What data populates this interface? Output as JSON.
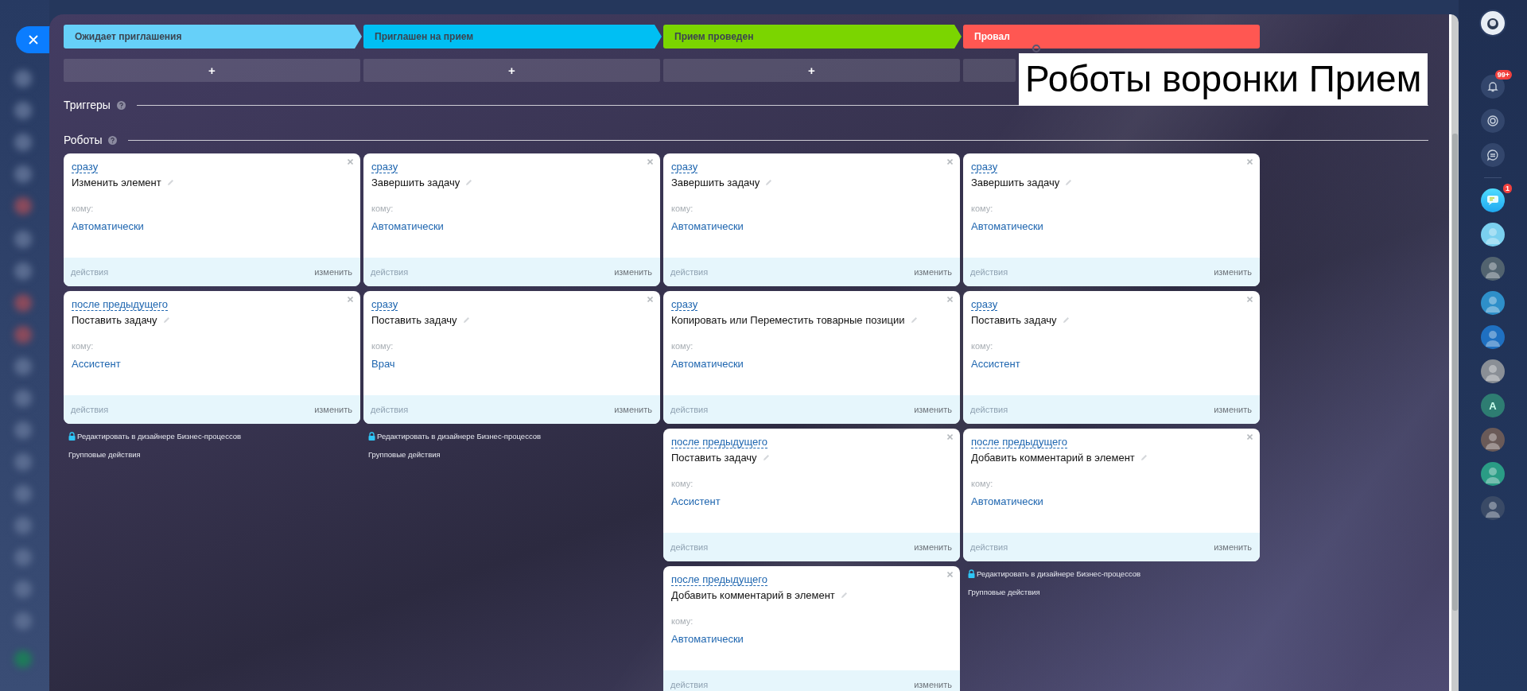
{
  "stages": [
    {
      "name": "Ожидает приглашения",
      "color": "#66d0f9",
      "add_label": "+"
    },
    {
      "name": "Приглашен на прием",
      "color": "#00bff3",
      "add_label": "+"
    },
    {
      "name": "Прием проведен",
      "color": "#7bd500",
      "add_label": "+"
    },
    {
      "name": "Провал",
      "color": "#ff5752"
    }
  ],
  "sections": {
    "triggers": "Триггеры",
    "robots": "Роботы"
  },
  "columns": [
    {
      "robots": [
        {
          "delay": "сразу",
          "title": "Изменить элемент",
          "to_label": "кому:",
          "assignee": "Автоматически",
          "actions": "действия",
          "edit": "изменить"
        },
        {
          "delay": "после предыдущего",
          "title": "Поставить задачу",
          "to_label": "кому:",
          "assignee": "Ассистент",
          "actions": "действия",
          "edit": "изменить"
        }
      ],
      "links": [
        "Редактировать в дизайнере Бизнес-процессов",
        "Групповые действия"
      ]
    },
    {
      "robots": [
        {
          "delay": "сразу",
          "title": "Завершить задачу",
          "to_label": "кому:",
          "assignee": "Автоматически",
          "actions": "действия",
          "edit": "изменить"
        },
        {
          "delay": "сразу",
          "title": "Поставить задачу",
          "to_label": "кому:",
          "assignee": "Врач",
          "actions": "действия",
          "edit": "изменить"
        }
      ],
      "links": [
        "Редактировать в дизайнере Бизнес-процессов",
        "Групповые действия"
      ]
    },
    {
      "robots": [
        {
          "delay": "сразу",
          "title": "Завершить задачу",
          "to_label": "кому:",
          "assignee": "Автоматически",
          "actions": "действия",
          "edit": "изменить"
        },
        {
          "delay": "сразу",
          "title": "Копировать или Переместить товарные позиции",
          "to_label": "кому:",
          "assignee": "Автоматически",
          "actions": "действия",
          "edit": "изменить"
        },
        {
          "delay": "после предыдущего",
          "title": "Поставить задачу",
          "to_label": "кому:",
          "assignee": "Ассистент",
          "actions": "действия",
          "edit": "изменить"
        },
        {
          "delay": "после предыдущего",
          "title": "Добавить комментарий в элемент",
          "to_label": "кому:",
          "assignee": "Автоматически",
          "actions": "действия",
          "edit": "изменить"
        }
      ]
    },
    {
      "robots": [
        {
          "delay": "сразу",
          "title": "Завершить задачу",
          "to_label": "кому:",
          "assignee": "Автоматически",
          "actions": "действия",
          "edit": "изменить"
        },
        {
          "delay": "сразу",
          "title": "Поставить задачу",
          "to_label": "кому:",
          "assignee": "Ассистент",
          "actions": "действия",
          "edit": "изменить"
        },
        {
          "delay": "после предыдущего",
          "title": "Добавить комментарий в элемент",
          "to_label": "кому:",
          "assignee": "Автоматически",
          "actions": "действия",
          "edit": "изменить"
        }
      ],
      "links": [
        "Редактировать в дизайнере Бизнес-процессов",
        "Групповые действия"
      ]
    }
  ],
  "caption": "Роботы воронки Прием",
  "right_bar": {
    "notification_badge": "99+",
    "chat_badge": "1",
    "avatar_letter": "A"
  }
}
